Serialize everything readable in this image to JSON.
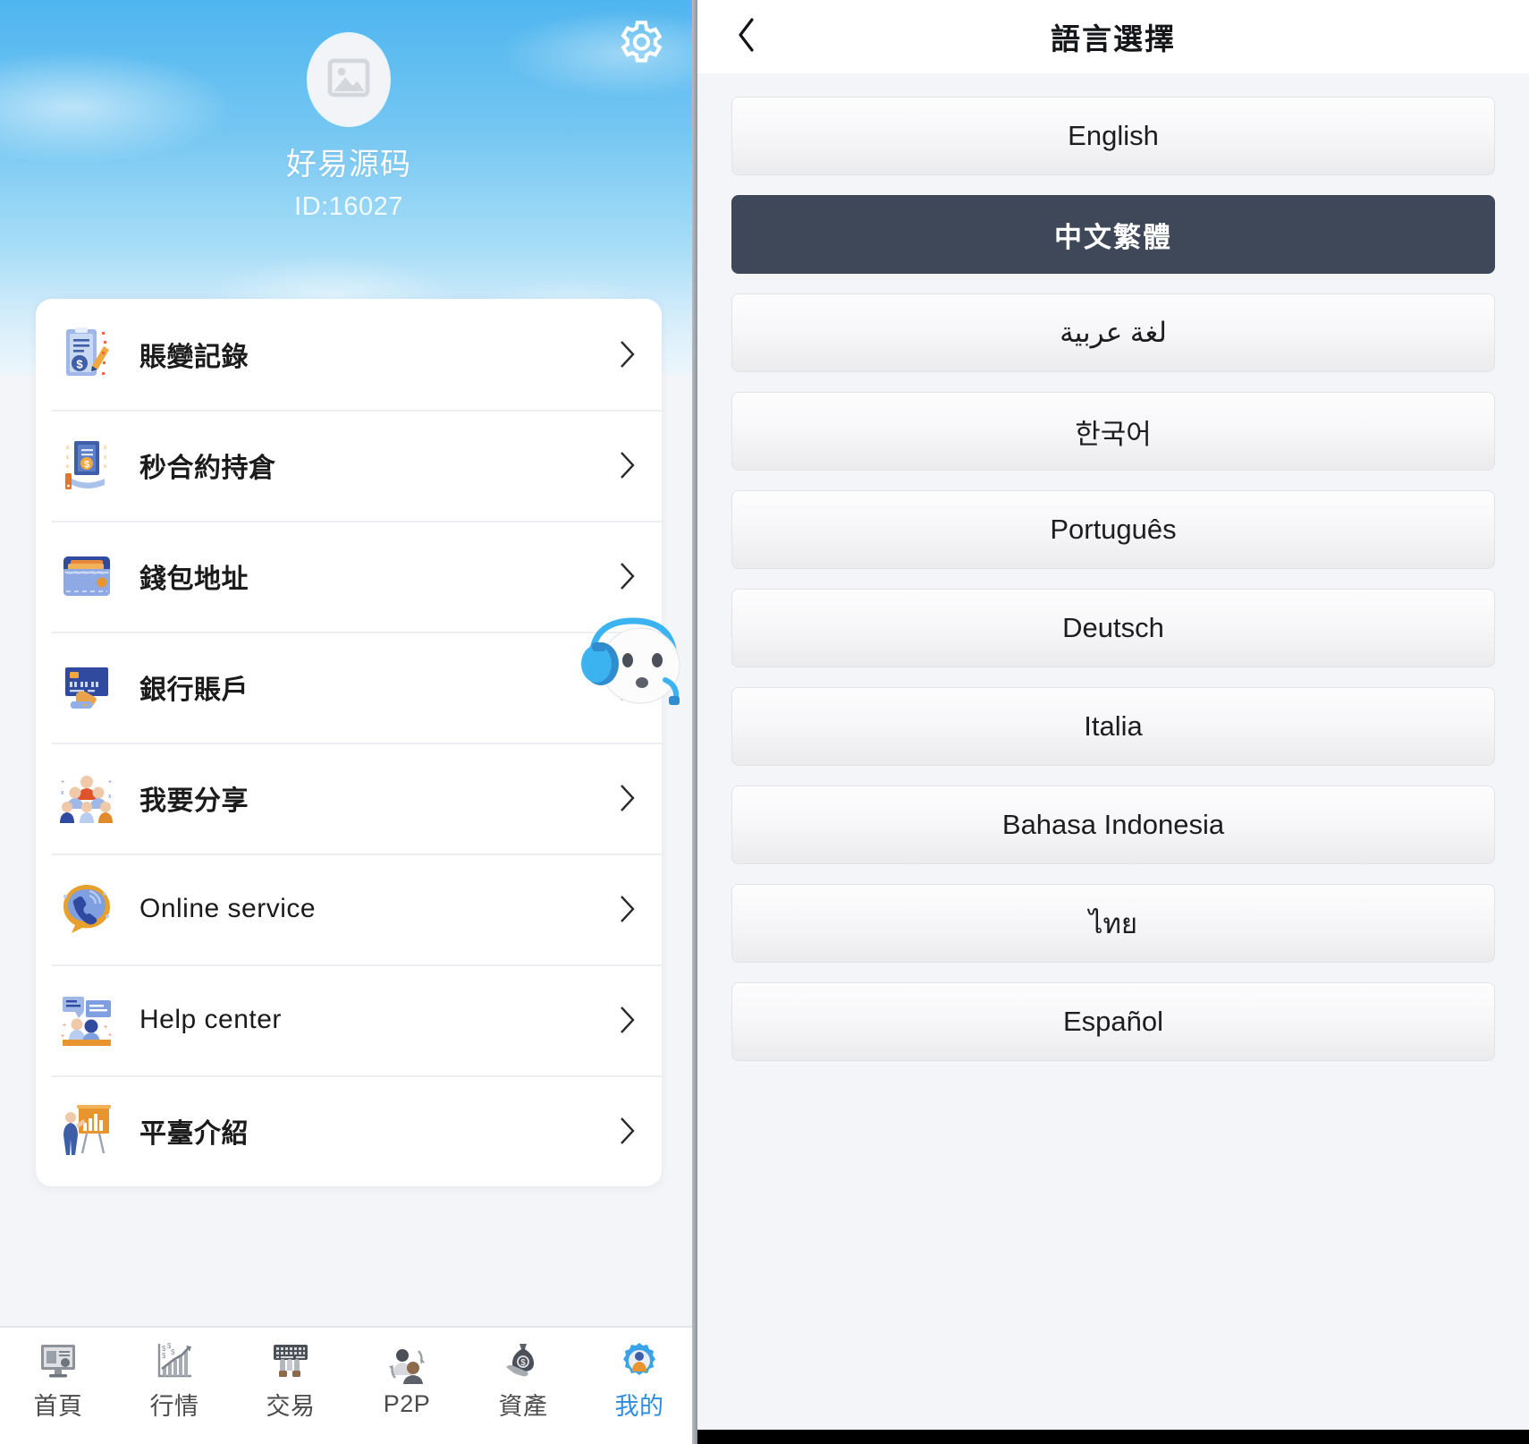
{
  "left": {
    "gear_icon": "gear-icon",
    "avatar_placeholder_icon": "image-placeholder-icon",
    "nickname": "好易源码",
    "user_id": "ID:16027",
    "menu_items": [
      {
        "label": "賬變記錄",
        "icon": "account-change-record-icon",
        "script": "cjk"
      },
      {
        "label": "秒合約持倉",
        "icon": "second-contract-position-icon",
        "script": "cjk"
      },
      {
        "label": "錢包地址",
        "icon": "wallet-address-icon",
        "script": "cjk"
      },
      {
        "label": "銀行賬戶",
        "icon": "bank-account-icon",
        "script": "cjk"
      },
      {
        "label": "我要分享",
        "icon": "share-people-icon",
        "script": "cjk"
      },
      {
        "label": "Online service",
        "icon": "online-service-phone-icon",
        "script": "latin"
      },
      {
        "label": "Help center",
        "icon": "help-center-chat-icon",
        "script": "latin"
      },
      {
        "label": "平臺介紹",
        "icon": "platform-intro-presentation-icon",
        "script": "cjk"
      }
    ],
    "mascot_icon": "customer-service-robot-icon",
    "tabs": [
      {
        "label": "首頁",
        "icon": "home-monitor-icon",
        "active": false
      },
      {
        "label": "行情",
        "icon": "market-chart-icon",
        "active": false
      },
      {
        "label": "交易",
        "icon": "trade-keyboard-icon",
        "active": false
      },
      {
        "label": "P2P",
        "icon": "p2p-users-icon",
        "active": false
      },
      {
        "label": "資產",
        "icon": "assets-moneybag-icon",
        "active": false
      },
      {
        "label": "我的",
        "icon": "mine-gear-user-icon",
        "active": true
      }
    ],
    "active_tab_color": "#2f8ce0"
  },
  "right": {
    "back_icon": "chevron-left-icon",
    "title": "語言選擇",
    "selected_color": "#3e4859",
    "languages": [
      {
        "label": "English",
        "selected": false,
        "script": "latin"
      },
      {
        "label": "中文繁體",
        "selected": true,
        "script": "cjk"
      },
      {
        "label": "لغة عربية",
        "selected": false,
        "script": "arabic"
      },
      {
        "label": "한국어",
        "selected": false,
        "script": "cjk"
      },
      {
        "label": "Português",
        "selected": false,
        "script": "latin"
      },
      {
        "label": "Deutsch",
        "selected": false,
        "script": "latin"
      },
      {
        "label": "Italia",
        "selected": false,
        "script": "latin"
      },
      {
        "label": "Bahasa Indonesia",
        "selected": false,
        "script": "latin"
      },
      {
        "label": "ไทย",
        "selected": false,
        "script": "thai"
      },
      {
        "label": "Español",
        "selected": false,
        "script": "latin"
      }
    ]
  }
}
